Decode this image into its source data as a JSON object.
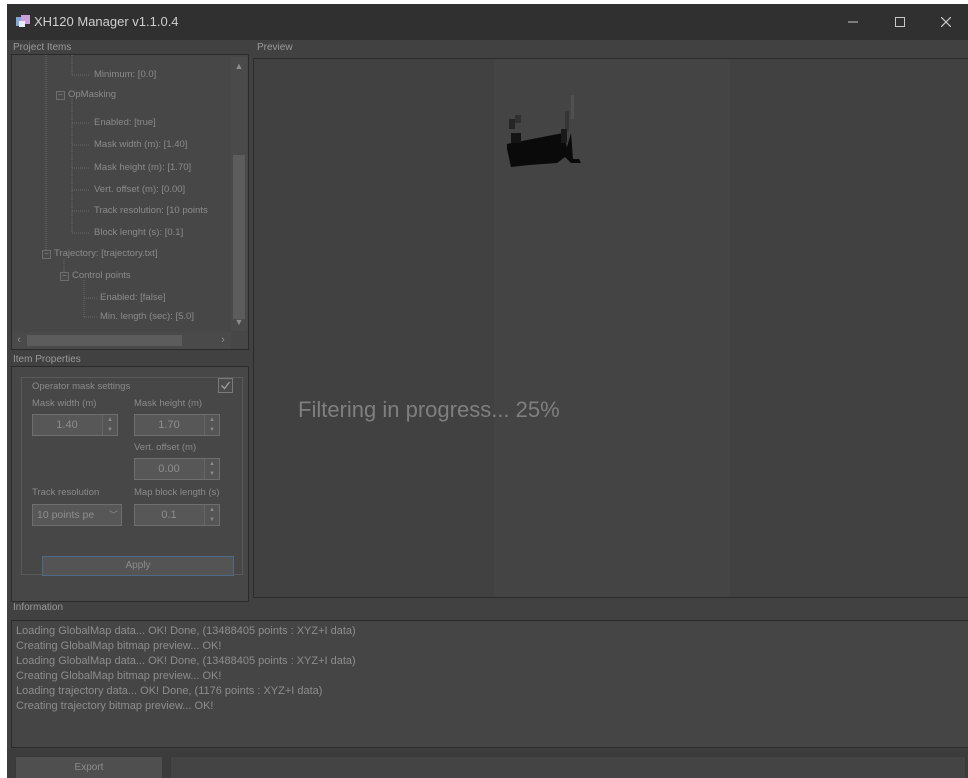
{
  "window": {
    "title": "XH120 Manager v1.1.0.4"
  },
  "sections": {
    "project_items": "Project Items",
    "preview": "Preview",
    "item_properties": "Item Properties",
    "information": "Information"
  },
  "tree": {
    "nodes": [
      {
        "label": "Minimum: [0.0]"
      },
      {
        "label": "OpMasking"
      },
      {
        "label": "Enabled: [true]"
      },
      {
        "label": "Mask width (m): [1.40]"
      },
      {
        "label": "Mask height (m): [1.70]"
      },
      {
        "label": "Vert. offset (m): [0.00]"
      },
      {
        "label": "Track resolution: [10 points"
      },
      {
        "label": "Block lenght (s): [0.1]"
      },
      {
        "label": "Trajectory: [trajectory.txt]"
      },
      {
        "label": "Control points"
      },
      {
        "label": "Enabled: [false]"
      },
      {
        "label": "Min. length (sec): [5.0]"
      }
    ]
  },
  "props": {
    "group_title": "Operator mask settings",
    "enabled": true,
    "mask_width_label": "Mask width (m)",
    "mask_width_value": "1.40",
    "mask_height_label": "Mask height (m)",
    "mask_height_value": "1.70",
    "vert_offset_label": "Vert. offset (m)",
    "vert_offset_value": "0.00",
    "track_resolution_label": "Track resolution",
    "track_resolution_value": "10 points pe",
    "map_block_label": "Map block length (s)",
    "map_block_value": "0.1",
    "apply_label": "Apply"
  },
  "preview": {
    "status": "Filtering in progress... 25%",
    "progress_percent": 25
  },
  "log": [
    "Loading GlobalMap data... OK! Done, (13488405 points : XYZ+I data)",
    "Creating GlobalMap bitmap preview... OK!",
    "Loading GlobalMap data... OK! Done, (13488405 points : XYZ+I data)",
    "Creating GlobalMap bitmap preview... OK!",
    "Loading trajectory data... OK! Done, (1176 points : XYZ+I data)",
    "Creating trajectory bitmap preview... OK!"
  ],
  "footer": {
    "export_label": "Export"
  },
  "icons": {
    "app": "app-logo-icon",
    "minimize": "minimize-icon",
    "maximize": "maximize-icon",
    "close": "close-icon"
  }
}
